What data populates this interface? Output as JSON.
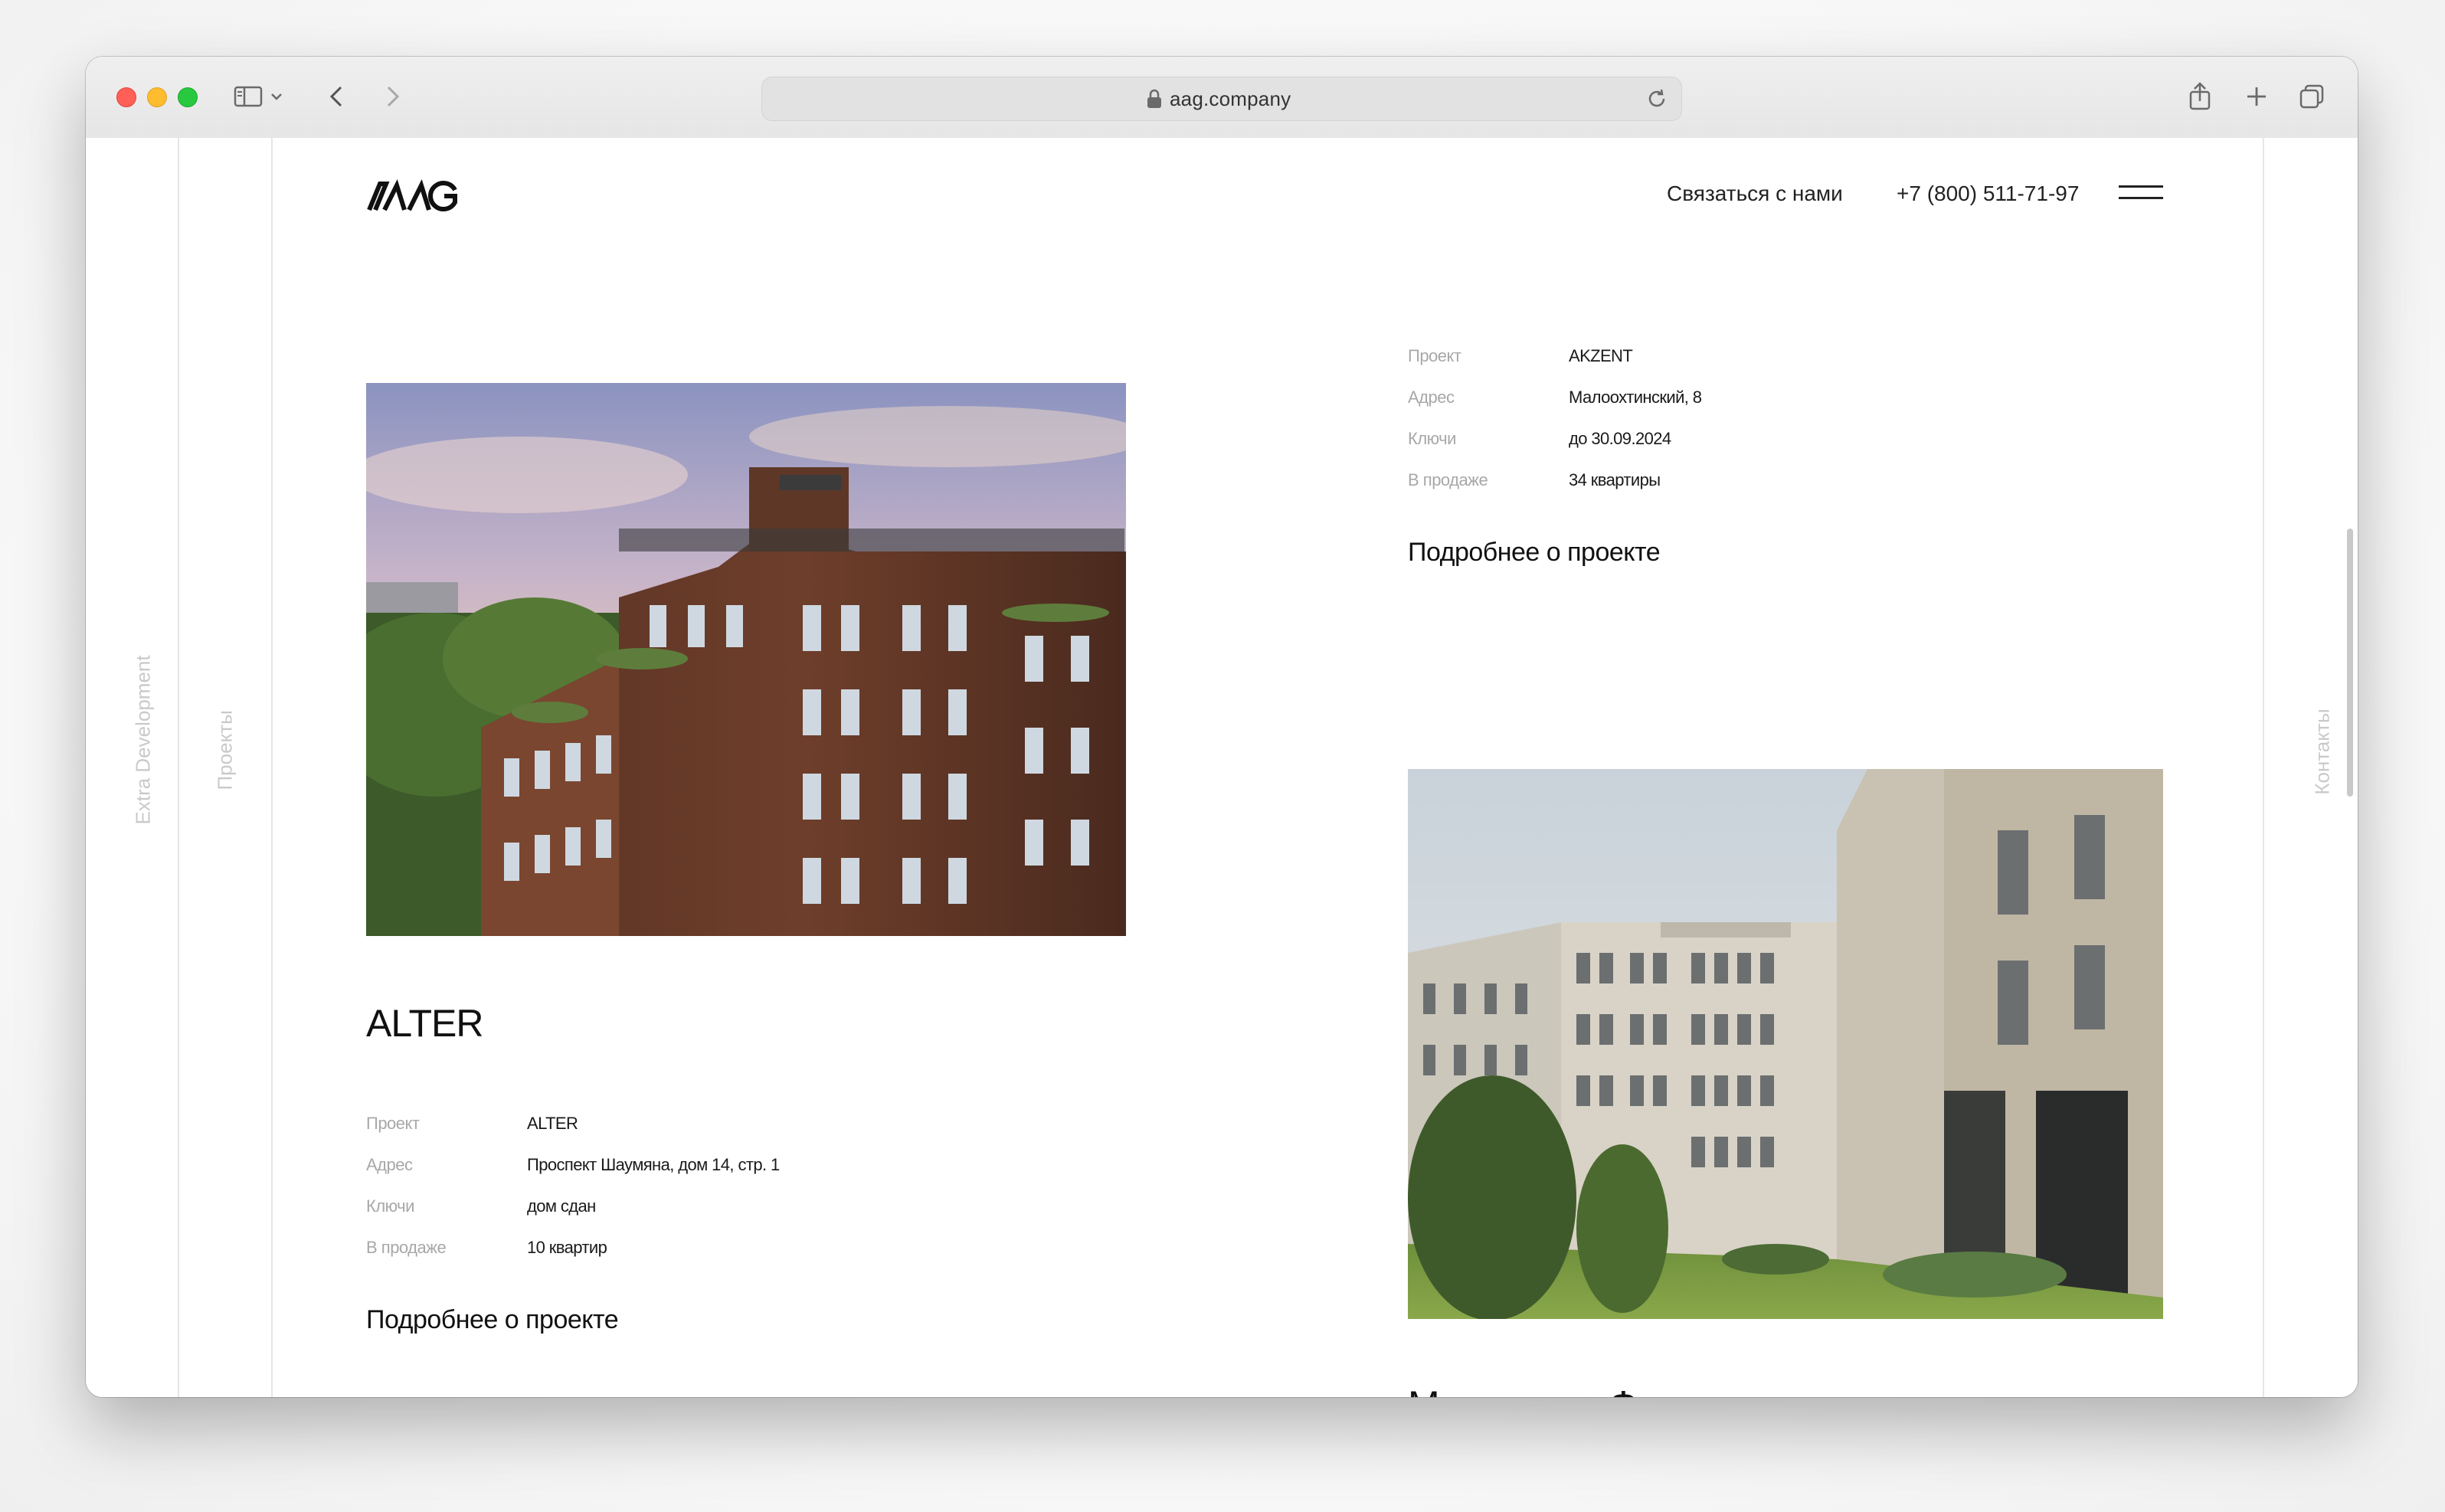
{
  "browser": {
    "url": "aag.company"
  },
  "side": {
    "left_outer": "Extra Development",
    "left_inner": "Проекты",
    "right": "Контакты"
  },
  "header": {
    "contact_label": "Связаться с нами",
    "phone": "+7 (800) 511-71-97"
  },
  "projects": [
    {
      "title": "",
      "rows": [
        {
          "key": "Проект",
          "value": "AKZENT"
        },
        {
          "key": "Адрес",
          "value": "Малоохтинский, 8"
        },
        {
          "key": "Ключи",
          "value": "до 30.09.2024"
        },
        {
          "key": "В продаже",
          "value": "34 квартиры"
        }
      ],
      "more_label": "Подробнее о проекте"
    },
    {
      "title": "ALTER",
      "rows": [
        {
          "key": "Проект",
          "value": "ALTER"
        },
        {
          "key": "Адрес",
          "value": "Проспект Шаумяна, дом 14, стр. 1"
        },
        {
          "key": "Ключи",
          "value": "дом сдан"
        },
        {
          "key": "В продаже",
          "value": "10 квартир"
        }
      ],
      "more_label": "Подробнее о проекте"
    },
    {
      "title": "Маленькая Франция"
    }
  ],
  "colors": {
    "accent_dot": "#e8453c",
    "text": "#111111",
    "muted": "#a8a8a8"
  }
}
